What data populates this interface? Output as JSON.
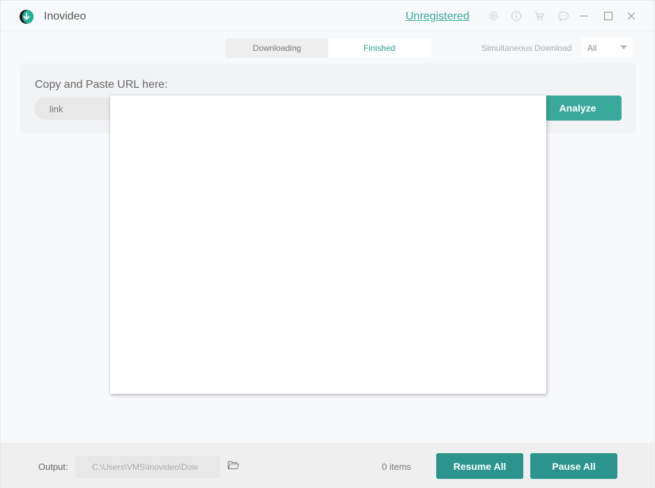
{
  "app": {
    "title": "Inovideo",
    "registration_link": "Unregistered"
  },
  "titlebar_icons": [
    {
      "name": "settings-icon"
    },
    {
      "name": "info-icon"
    },
    {
      "name": "cart-icon"
    },
    {
      "name": "feedback-icon"
    },
    {
      "name": "minimize-icon"
    },
    {
      "name": "maximize-icon"
    },
    {
      "name": "close-icon"
    }
  ],
  "tabs": [
    {
      "label": "Downloading",
      "active": false
    },
    {
      "label": "Finished",
      "active": true
    }
  ],
  "simultaneous": {
    "label": "Simultaneous Download",
    "selected": "All"
  },
  "url_panel": {
    "label": "Copy and Paste URL here:",
    "input_value": "link",
    "analyze_label": "Analyze"
  },
  "footer": {
    "output_label": "Output:",
    "output_path": "C:\\Users\\VMS\\Inovideo\\Dow",
    "items_count": "0 items",
    "resume_label": "Resume All",
    "pause_label": "Pause All"
  },
  "colors": {
    "accent": "#3aa89a",
    "button_dark": "#2b958d"
  }
}
